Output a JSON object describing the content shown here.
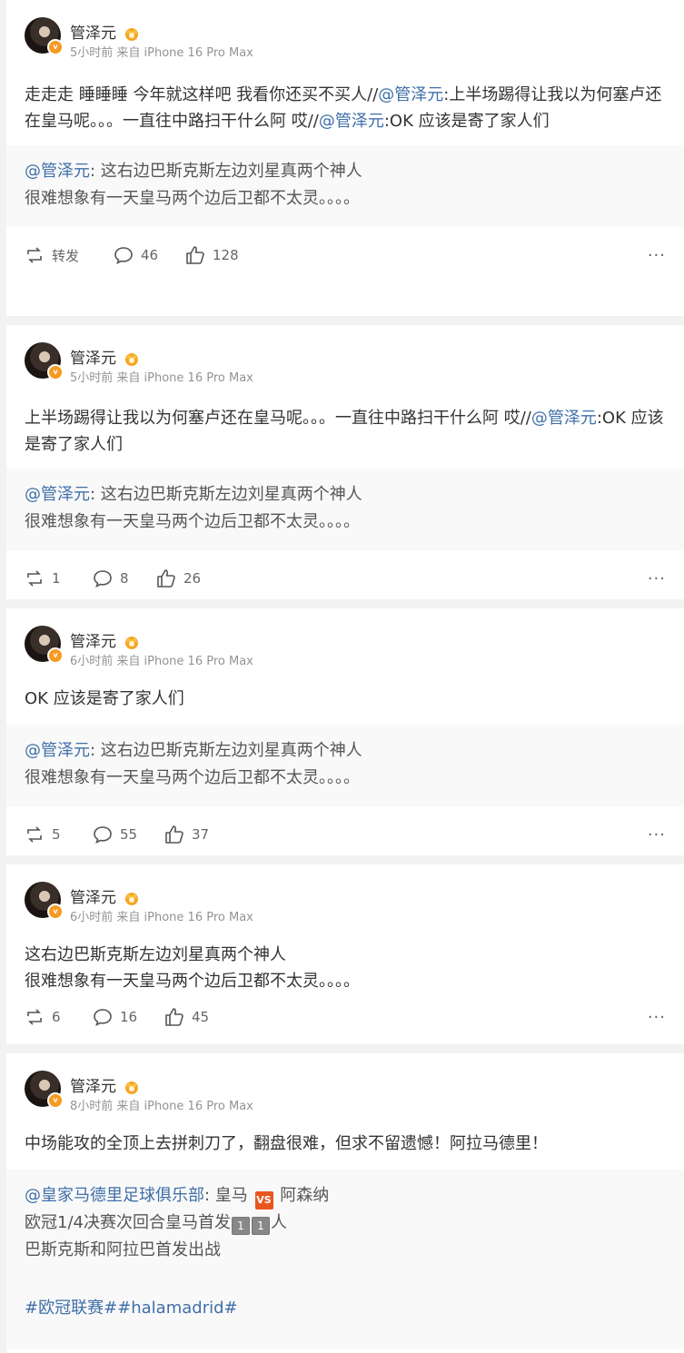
{
  "posts": [
    {
      "author": "管泽元",
      "meta": "5小时前 来自 iPhone 16 Pro Max",
      "text_plain": "走走走 睡睡睡 今年就这样吧 我看你还买不买人//",
      "mention1": "@管泽元",
      "text_mid": ":上半场踢得让我以为何塞卢还在皇马呢。。。一直往中路扫干什么阿 哎//",
      "mention2": "@管泽元",
      "text_end": ":OK 应该是寄了家人们",
      "quote_mention": "@管泽元",
      "quote_line1": ": 这右边巴斯克斯左边刘星真两个神人",
      "quote_line2": "很难想象有一天皇马两个边后卫都不太灵。。。。",
      "repost": "转发",
      "comments": "46",
      "likes": "128"
    },
    {
      "author": "管泽元",
      "meta": "5小时前 来自 iPhone 16 Pro Max",
      "text_plain": "上半场踢得让我以为何塞卢还在皇马呢。。。一直往中路扫干什么阿 哎//",
      "mention1": "@管泽元",
      "text_end": ":OK 应该是寄了家人们",
      "quote_mention": "@管泽元",
      "quote_line1": ": 这右边巴斯克斯左边刘星真两个神人",
      "quote_line2": "很难想象有一天皇马两个边后卫都不太灵。。。。",
      "repost": "1",
      "comments": "8",
      "likes": "26"
    },
    {
      "author": "管泽元",
      "meta": "6小时前 来自 iPhone 16 Pro Max",
      "text_plain": "OK 应该是寄了家人们",
      "quote_mention": "@管泽元",
      "quote_line1": ": 这右边巴斯克斯左边刘星真两个神人",
      "quote_line2": "很难想象有一天皇马两个边后卫都不太灵。。。。",
      "repost": "5",
      "comments": "55",
      "likes": "37"
    },
    {
      "author": "管泽元",
      "meta": "6小时前 来自 iPhone 16 Pro Max",
      "line1": "这右边巴斯克斯左边刘星真两个神人",
      "line2": "很难想象有一天皇马两个边后卫都不太灵。。。。",
      "repost": "6",
      "comments": "16",
      "likes": "45"
    },
    {
      "author": "管泽元",
      "meta": "8小时前 来自 iPhone 16 Pro Max",
      "text_plain": "中场能攻的全顶上去拼刺刀了，翻盘很难，但求不留遗憾！阿拉马德里！",
      "quote_mention": "@皇家马德里足球俱乐部",
      "quote_a": ": 皇马 ",
      "quote_vs": "VS",
      "quote_b": " 阿森纳",
      "quote_line2a": "欧冠1/4决赛次回合皇马首发",
      "quote_box1": "1",
      "quote_box2": "1",
      "quote_line2b": "人",
      "quote_line3": "巴斯克斯和阿拉巴首发出战",
      "quote_tags": "#欧冠联赛##halamadrid#"
    }
  ],
  "more_label": "···"
}
